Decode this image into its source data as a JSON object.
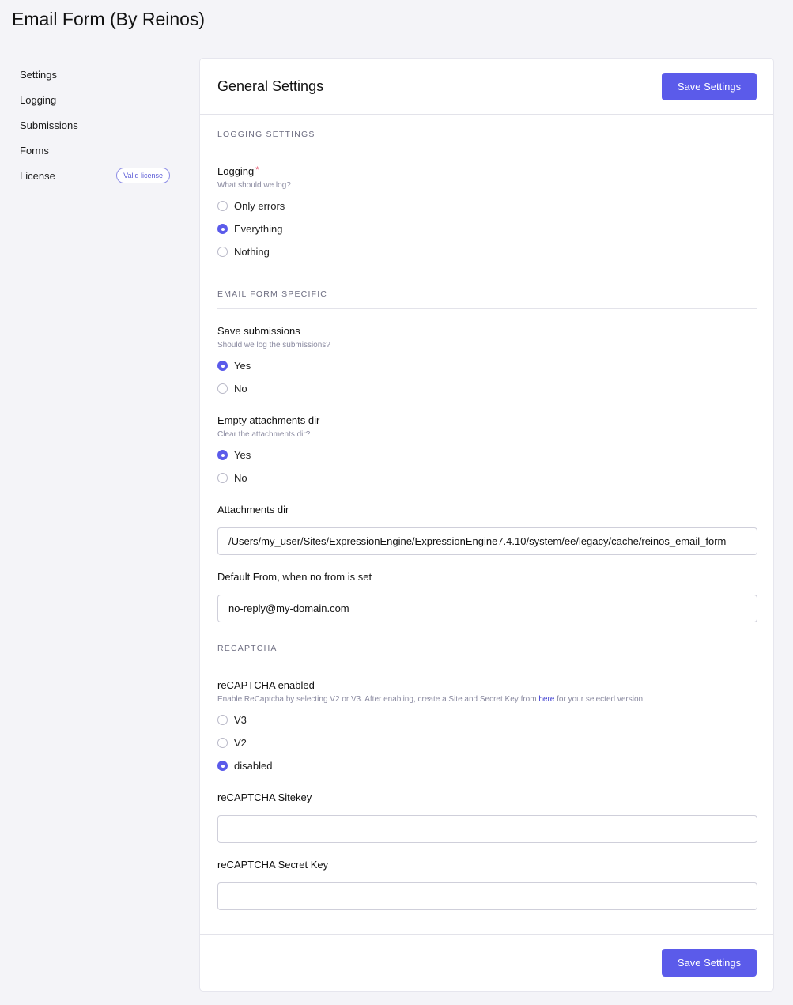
{
  "page": {
    "title": "Email Form (By Reinos)"
  },
  "sidebar": {
    "items": [
      {
        "label": "Settings"
      },
      {
        "label": "Logging"
      },
      {
        "label": "Submissions"
      },
      {
        "label": "Forms"
      },
      {
        "label": "License",
        "badge": "Valid license"
      }
    ]
  },
  "panel": {
    "title": "General Settings",
    "save_label": "Save Settings",
    "footer_save_label": "Save Settings"
  },
  "logging_section": {
    "heading": "LOGGING SETTINGS",
    "logging": {
      "label": "Logging",
      "required_mark": "*",
      "desc": "What should we log?",
      "options": [
        "Only errors",
        "Everything",
        "Nothing"
      ],
      "selected": "Everything"
    }
  },
  "email_section": {
    "heading": "EMAIL FORM SPECIFIC",
    "save_submissions": {
      "label": "Save submissions",
      "desc": "Should we log the submissions?",
      "options": [
        "Yes",
        "No"
      ],
      "selected": "Yes"
    },
    "empty_attachments": {
      "label": "Empty attachments dir",
      "desc": "Clear the attachments dir?",
      "options": [
        "Yes",
        "No"
      ],
      "selected": "Yes"
    },
    "attachments_dir": {
      "label": "Attachments dir",
      "value": "/Users/my_user/Sites/ExpressionEngine/ExpressionEngine7.4.10/system/ee/legacy/cache/reinos_email_form"
    },
    "default_from": {
      "label": "Default From, when no from is set",
      "value": "no-reply@my-domain.com"
    }
  },
  "recaptcha_section": {
    "heading": "RECAPTCHA",
    "enabled": {
      "label": "reCAPTCHA enabled",
      "desc_before": "Enable ReCaptcha by selecting V2 or V3. After enabling, create a Site and Secret Key from ",
      "desc_link": "here",
      "desc_after": " for your selected version.",
      "options": [
        "V3",
        "V2",
        "disabled"
      ],
      "selected": "disabled"
    },
    "sitekey": {
      "label": "reCAPTCHA Sitekey",
      "value": ""
    },
    "secret": {
      "label": "reCAPTCHA Secret Key",
      "value": ""
    }
  },
  "colors": {
    "accent": "#5b5bea",
    "background": "#f4f4f8",
    "required": "#e0405a"
  }
}
